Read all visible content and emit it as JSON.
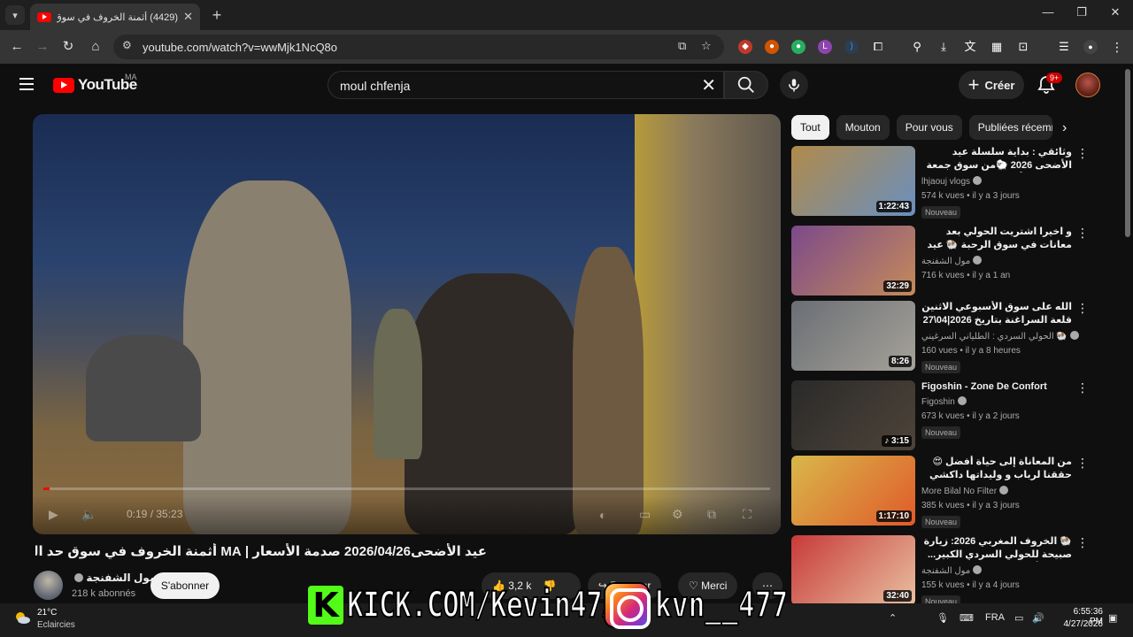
{
  "browser": {
    "tab_title": "(4429) أثمنة الخروف في سوق",
    "url": "youtube.com/watch?v=wwMjk1NcQ8o"
  },
  "yt": {
    "logo_text": "YouTube",
    "country": "MA",
    "search_value": "moul chfenja",
    "create_label": "Créer",
    "notif_count": "9+"
  },
  "player": {
    "time": "0:19 / 35:23",
    "progress_fraction": 0.009
  },
  "video": {
    "title": "عيد الأضحى2026/04/26 صدمة الأسعار | MA أثمنة الخروف في سوق حد البروج اليوم 🔥",
    "channel": "مول الشفنجة",
    "subscribers": "218 k abonnés",
    "subscribe_label": "S'abonner",
    "likes": "3,2 k",
    "share_label": "Partager",
    "thanks_label": "Merci"
  },
  "chips": [
    "Tout",
    "Mouton",
    "Pour vous",
    "Publiées récemment"
  ],
  "recommendations": [
    {
      "title": "وثائقي : بداية سلسلة عيد الأضحى 2026 🐑من سوق جمعة كيسر | مع أثمنة الحولي ...",
      "rtl": true,
      "channel": "lhjaouj vlogs",
      "meta": "574 k vues • il y a 3 jours",
      "badge": "Nouveau",
      "duration": "1:22:43",
      "thumb": [
        "#b08a4a",
        "#6a8fbf"
      ]
    },
    {
      "title": "و اخيرا اشتريت الحولي بعد معانات في سوق الرحبة 🐏 عيد الاضحى MA",
      "rtl": true,
      "channel": "مول الشفنجة",
      "meta": "716 k vues • il y a 1 an",
      "badge": "",
      "duration": "32:29",
      "thumb": [
        "#7b4a8a",
        "#c58a5a"
      ]
    },
    {
      "title": "الله على سوق الأسبوعي الاثنين قلعة السراغنة بتاريخ 2026|04\\27",
      "rtl": true,
      "channel": "الحولي السردي : الطلياني السرغيني 🐏",
      "meta": "160 vues • il y a 8 heures",
      "badge": "Nouveau",
      "duration": "8:26",
      "thumb": [
        "#6a6e74",
        "#a6a29a"
      ]
    },
    {
      "title": "Figoshin - Zone De Confort",
      "rtl": false,
      "channel": "Figoshin",
      "meta": "673 k vues • il y a 2 jours",
      "badge": "Nouveau",
      "duration": "♪ 3:15",
      "thumb": [
        "#2a2a2a",
        "#4e4438"
      ]
    },
    {
      "title": "من المعاناة إلى حياة أفضل 😍 حققنا لرباب و وليداتها داكشي لي كانت كاتحلم بيه",
      "rtl": true,
      "channel": "More Bilal No Filter",
      "meta": "385 k vues • il y a 3 jours",
      "badge": "Nouveau",
      "duration": "1:17:10",
      "thumb": [
        "#d8b84a",
        "#e05a2a"
      ]
    },
    {
      "title": "🐏 الخروف المغربي 2026: زيارة صبيحة للحولي السردي الكبير... واش الأثمنة معقولة؟",
      "rtl": true,
      "channel": "مول الشفنجة",
      "meta": "155 k vues • il y a 4 jours",
      "badge": "Nouveau",
      "duration": "32:40",
      "thumb": [
        "#c83a3a",
        "#e8c0a0"
      ]
    }
  ],
  "taskbar": {
    "temp": "21°C",
    "weather": "Eclaircies",
    "lang": "FRA",
    "time": "6:55:36 PM",
    "date": "4/27/2026"
  },
  "overlay": {
    "kick_letter": "K",
    "kick_text": "KICK.COM/Kevin47A",
    "ig_text": "kvn__477"
  },
  "colors": {
    "accent_red": "#ff0000",
    "kick_green": "#53fc18"
  }
}
